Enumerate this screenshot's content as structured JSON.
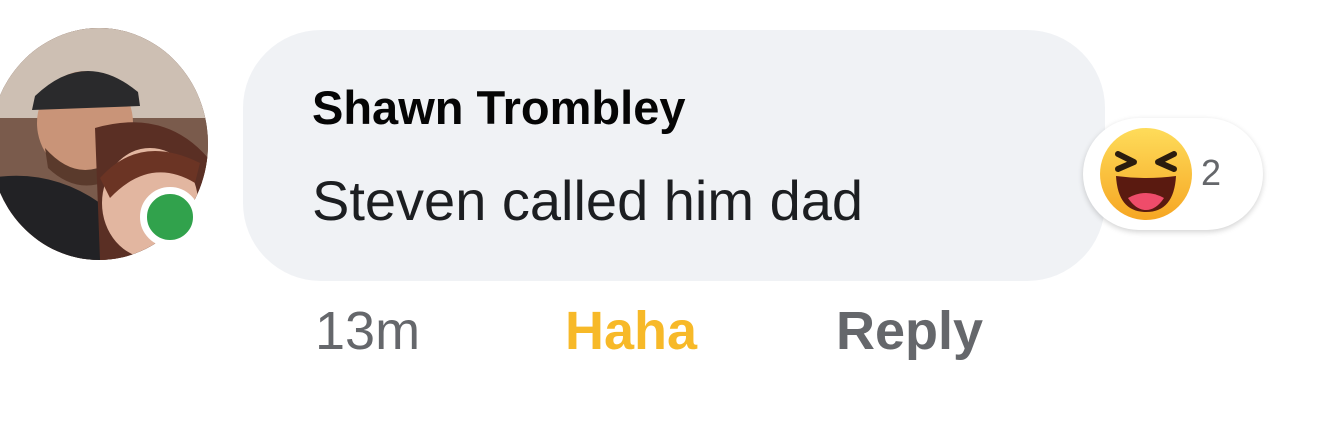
{
  "comment": {
    "author": "Shawn Trombley",
    "text": "Steven called him dad",
    "timestamp": "13m",
    "reaction_label": "Haha",
    "reply_label": "Reply",
    "reaction_count": "2",
    "reaction_icon": "haha-emoji-icon",
    "online_status_icon": "online-status-icon"
  },
  "colors": {
    "bubble": "#f0f2f5",
    "online": "#31a24c",
    "haha": "#f7b928",
    "secondary_text": "#65676b"
  }
}
